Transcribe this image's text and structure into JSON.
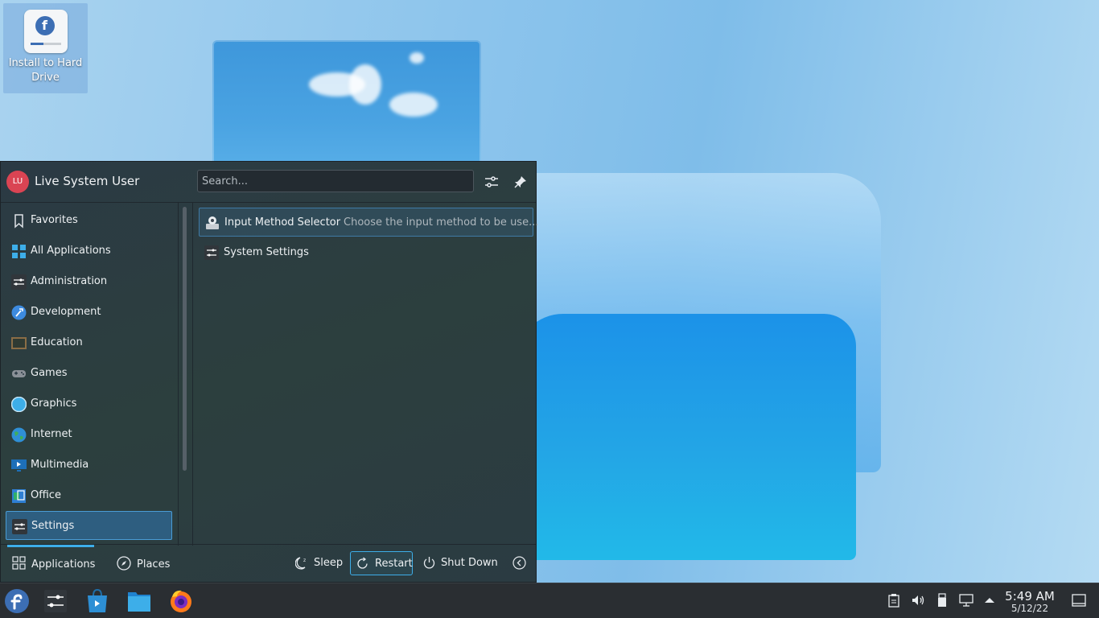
{
  "desktop": {
    "icon_label": "Install to Hard Drive"
  },
  "launcher": {
    "user_initials": "LU",
    "user_name": "Live System User",
    "search_placeholder": "Search...",
    "categories": [
      {
        "label": "Favorites",
        "icon": "bookmark-icon",
        "color": "#dfe3e7"
      },
      {
        "label": "All Applications",
        "icon": "grid-icon",
        "color": "#3daee9"
      },
      {
        "label": "Administration",
        "icon": "sliders-icon",
        "color": "#31363b"
      },
      {
        "label": "Development",
        "icon": "hammer-icon",
        "color": "#3d8be0"
      },
      {
        "label": "Education",
        "icon": "chalkboard-icon",
        "color": "#5a4c3c"
      },
      {
        "label": "Games",
        "icon": "gamepad-icon",
        "color": "#8a9097"
      },
      {
        "label": "Graphics",
        "icon": "graphics-icon",
        "color": "#3daee9"
      },
      {
        "label": "Internet",
        "icon": "globe-icon",
        "color": "#2f8fd6"
      },
      {
        "label": "Multimedia",
        "icon": "monitor-icon",
        "color": "#1d6fb8"
      },
      {
        "label": "Office",
        "icon": "office-icon",
        "color": "#2e7fd3"
      },
      {
        "label": "Settings",
        "icon": "sliders-icon",
        "color": "#31363b"
      }
    ],
    "selected_category": "Settings",
    "items": [
      {
        "label": "Input Method Selector",
        "description": "Choose the input method to be use...",
        "icon": "input-method-icon"
      },
      {
        "label": "System Settings",
        "description": "",
        "icon": "system-settings-icon"
      }
    ],
    "footer": {
      "applications_tab": "Applications",
      "places_tab": "Places",
      "sleep": "Sleep",
      "restart": "Restart",
      "shutdown": "Shut Down"
    }
  },
  "taskbar": {
    "apps": [
      "fedora-launcher-icon",
      "system-settings-icon",
      "discover-icon",
      "dolphin-icon",
      "firefox-icon"
    ],
    "clock_time": "5:49 AM",
    "clock_date": "5/12/22"
  },
  "colors": {
    "accent": "#3daee9",
    "avatar": "#da4453",
    "fedora_blue": "#3c6eb4"
  }
}
